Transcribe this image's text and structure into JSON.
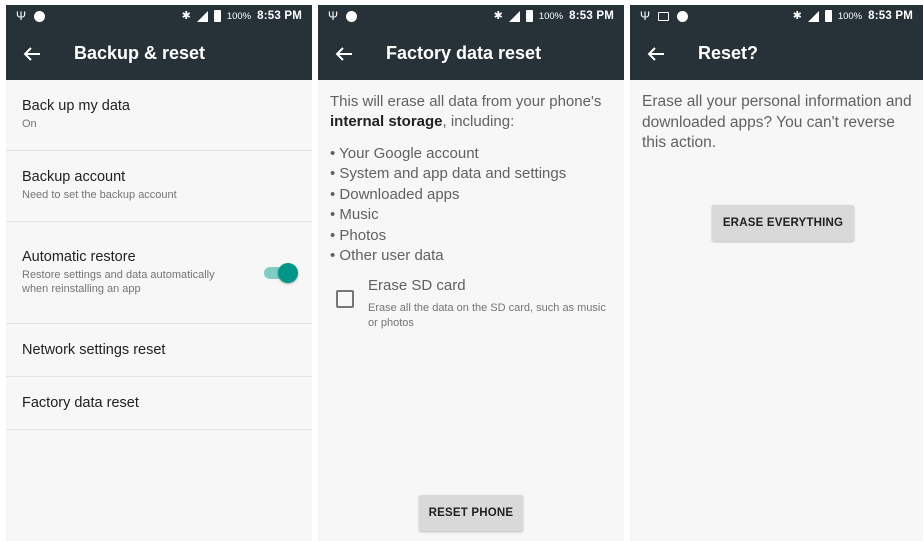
{
  "status_bar": {
    "battery": "100%",
    "time": "8:53 PM"
  },
  "screen1": {
    "title": "Backup & reset",
    "items": [
      {
        "title": "Back up my data",
        "summary": "On"
      },
      {
        "title": "Backup account",
        "summary": "Need to set the backup account"
      },
      {
        "title": "Automatic restore",
        "summary": "Restore settings and data automatically when reinstalling an app",
        "toggle_on": true
      },
      {
        "title": "Network settings reset",
        "summary": ""
      },
      {
        "title": "Factory data reset",
        "summary": ""
      }
    ]
  },
  "screen2": {
    "title": "Factory data reset",
    "intro_prefix": "This will erase all data from your phone's ",
    "intro_bold": "internal storage",
    "intro_suffix": ", including:",
    "bullets": [
      "Your Google account",
      "System and app data and settings",
      "Downloaded apps",
      "Music",
      "Photos",
      "Other user data"
    ],
    "erase_sd_title": "Erase SD card",
    "erase_sd_desc": "Erase all the data on the SD card, such as music or photos",
    "erase_sd_checked": false,
    "button": "RESET PHONE"
  },
  "screen3": {
    "title": "Reset?",
    "message": "Erase all your personal information and downloaded apps? You can't reverse this action.",
    "button": "ERASE EVERYTHING"
  },
  "colors": {
    "appbar": "#263238",
    "accent": "#009688",
    "background": "#f7f7f7"
  }
}
